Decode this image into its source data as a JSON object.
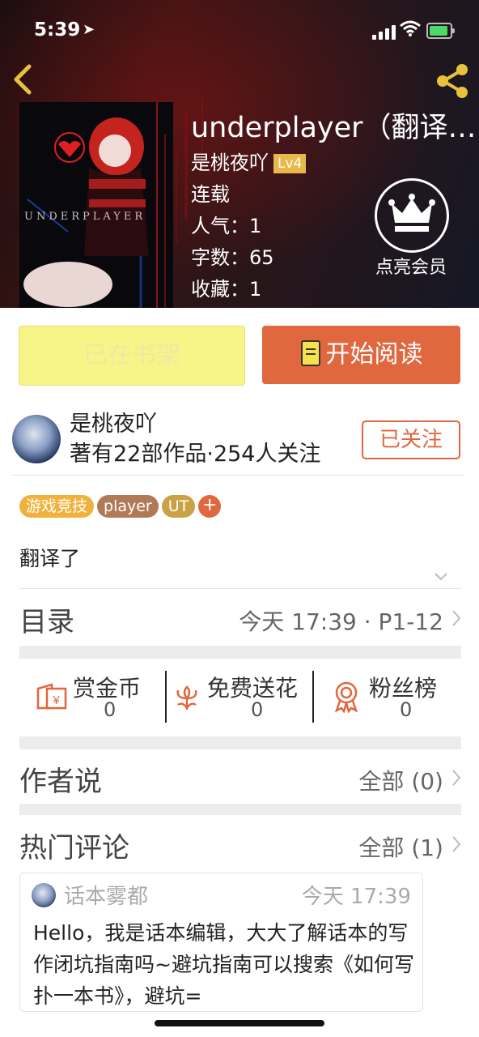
{
  "status_bar": {
    "time": "5:39"
  },
  "book": {
    "title": "underplayer（翻译…",
    "author": "是桃夜吖",
    "level": "Lv4",
    "status": "连载",
    "popularity": "人气：1",
    "word_count": "字数：65",
    "favorites": "收藏：1",
    "cover_text": "UNDERPLAYER",
    "description": "翻译了"
  },
  "vip": {
    "label": "点亮会员"
  },
  "actions": {
    "shelf_label": "已在书架",
    "read_label": "开始阅读"
  },
  "author_card": {
    "name": "是桃夜吖",
    "stats": "著有22部作品·254人关注",
    "follow_label": "已关注"
  },
  "tags": [
    {
      "label": "游戏竞技",
      "color": "#f0b23c"
    },
    {
      "label": "player",
      "color": "#b07a56"
    },
    {
      "label": "UT",
      "color": "#c9a244"
    }
  ],
  "tag_add": "+",
  "catalog": {
    "title": "目录",
    "info": "今天 17:39 · P1-12"
  },
  "rewards": [
    {
      "label": "赏金币",
      "value": "0",
      "icon": "coin-envelope-icon"
    },
    {
      "label": "免费送花",
      "value": "0",
      "icon": "flower-icon"
    },
    {
      "label": "粉丝榜",
      "value": "0",
      "icon": "medal-icon"
    }
  ],
  "author_says": {
    "title": "作者说",
    "link": "全部 (0)"
  },
  "hot_comments": {
    "title": "热门评论",
    "link": "全部 (1)"
  },
  "comment": {
    "user": "话本雾都",
    "time": "今天 17:39",
    "text": "Hello，我是话本编辑，大大了解话本的写作闭坑指南吗~避坑指南可以搜索《如何写扑一本书》，避坑="
  },
  "colors": {
    "accent": "#e1673e",
    "shelf_bg": "#f7f488",
    "level_badge": "#e8b84a"
  }
}
